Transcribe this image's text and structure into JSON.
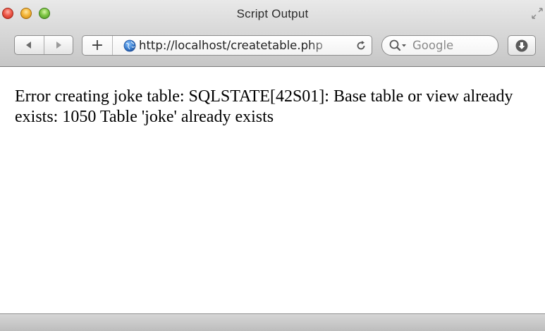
{
  "window": {
    "title": "Script Output"
  },
  "toolbar": {
    "back_icon": "back-arrow-icon",
    "forward_icon": "forward-arrow-icon",
    "add_bookmark_label": "+",
    "address": {
      "value": "http://localhost/createtable.php",
      "site_icon": "globe-icon",
      "reload_icon": "reload-icon"
    },
    "search": {
      "engine_icon": "search-icon",
      "placeholder": "Google"
    },
    "downloads_icon": "download-icon"
  },
  "content": {
    "message": "Error creating joke table: SQLSTATE[42S01]: Base table or view already exists: 1050 Table 'joke' already exists"
  },
  "colors": {
    "close": "#ee5a4b",
    "minimize": "#f5b73a",
    "zoom": "#7fc745",
    "globe": "#3a7fd0"
  }
}
